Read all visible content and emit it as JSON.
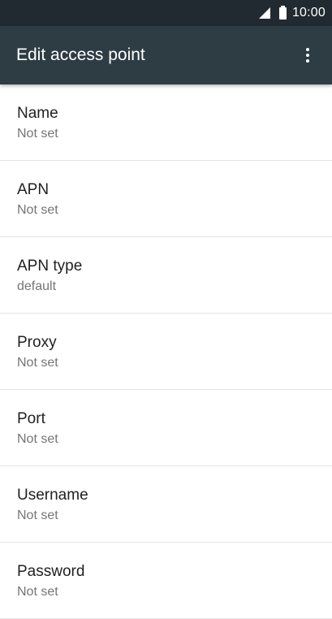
{
  "status_bar": {
    "time": "10:00",
    "icons": [
      "signal-icon",
      "battery-icon"
    ]
  },
  "app_bar": {
    "title": "Edit access point",
    "menu_icon": "more-vert-icon"
  },
  "colors": {
    "status_bar_bg": "#212a30",
    "app_bar_bg": "#2e3d44",
    "title_text": "#212121",
    "summary_text": "#757575",
    "divider": "#e4e4e4"
  },
  "preferences": [
    {
      "title": "Name",
      "summary": "Not set"
    },
    {
      "title": "APN",
      "summary": "Not set"
    },
    {
      "title": "APN type",
      "summary": "default"
    },
    {
      "title": "Proxy",
      "summary": "Not set"
    },
    {
      "title": "Port",
      "summary": "Not set"
    },
    {
      "title": "Username",
      "summary": "Not set"
    },
    {
      "title": "Password",
      "summary": "Not set"
    }
  ]
}
